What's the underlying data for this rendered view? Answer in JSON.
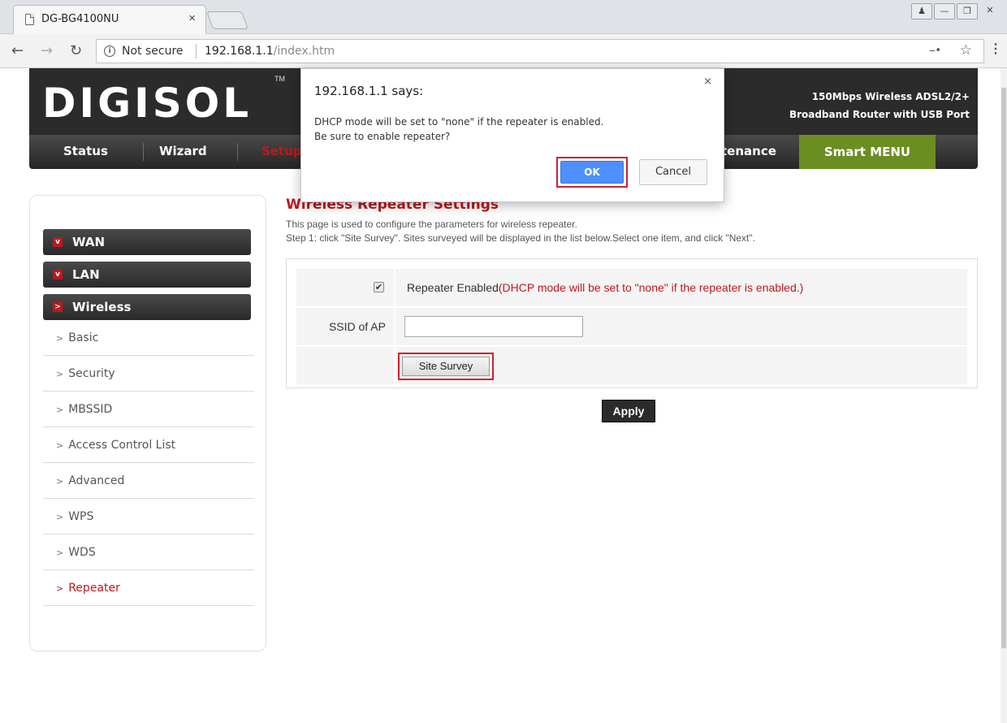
{
  "browser": {
    "tab_title": "DG-BG4100NU",
    "tab_close": "×",
    "security_label": "Not secure",
    "url_host": "192.168.1.1",
    "url_path": "/index.htm"
  },
  "header": {
    "logo": "DIGISOL",
    "trademark": "TM",
    "tagline_line1": "150Mbps Wireless ADSL2/2+",
    "tagline_line2": "Broadband Router with USB Port"
  },
  "nav": {
    "items": [
      "Status",
      "Wizard",
      "Setup",
      "Maintenance"
    ],
    "visible_labels": {
      "status": "Status",
      "wizard": "Wizard",
      "setup": "Setup",
      "maintenance": "tenance"
    },
    "smart_menu": "Smart MENU"
  },
  "sidebar": {
    "heads": [
      {
        "label": "WAN",
        "mark": "v"
      },
      {
        "label": "LAN",
        "mark": "v"
      },
      {
        "label": "Wireless",
        "mark": ">"
      }
    ],
    "subitems": [
      "Basic",
      "Security",
      "MBSSID",
      "Access Control List",
      "Advanced",
      "WPS",
      "WDS",
      "Repeater"
    ],
    "active_subitem": "Repeater"
  },
  "content": {
    "title": "Wireless Repeater Settings",
    "desc1": "This page is used to configure the parameters for wireless repeater.",
    "desc2": "Step 1: click \"Site Survey\". Sites surveyed will be displayed in the list below.Select one item, and click \"Next\".",
    "repeater_label": "Repeater Enabled",
    "repeater_note": "(DHCP mode will be set to \"none\" if the repeater is enabled.)",
    "repeater_checked": true,
    "ssid_label": "SSID of AP",
    "ssid_value": "",
    "site_survey_label": "Site Survey",
    "apply_label": "Apply"
  },
  "dialog": {
    "title": "192.168.1.1 says:",
    "close": "×",
    "line1": "DHCP mode will be set to \"none\" if the repeater is enabled.",
    "line2": "Be sure to enable repeater?",
    "ok_label": "OK",
    "cancel_label": "Cancel"
  },
  "colors": {
    "accent_red": "#c0171d",
    "smart_menu_green": "#6b8e23",
    "ok_blue": "#4d90fe",
    "highlight_red": "#d0202a"
  }
}
